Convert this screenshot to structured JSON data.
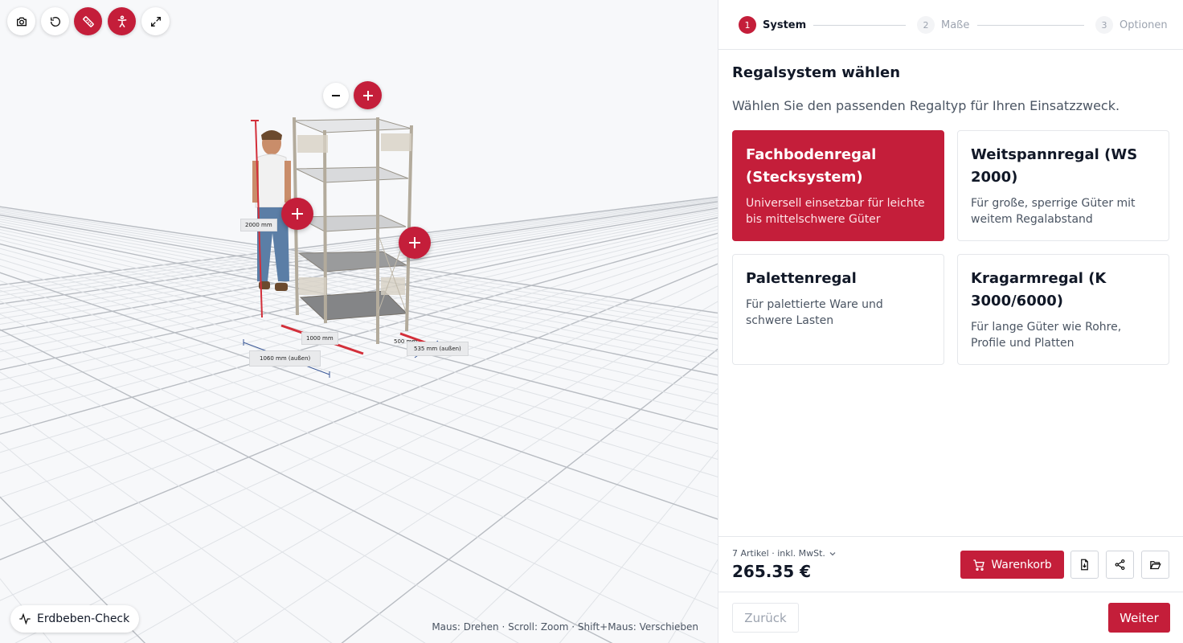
{
  "toolbar": {
    "buttons": [
      {
        "icon": "camera-icon"
      },
      {
        "icon": "reset-view-icon"
      },
      {
        "icon": "ruler-icon"
      },
      {
        "icon": "person-icon"
      },
      {
        "icon": "fullscreen-icon"
      }
    ]
  },
  "viewport": {
    "dimensions": {
      "height": "2000 mm",
      "width": "1000 mm",
      "width_outer": "1060 mm (außen)",
      "depth": "500 mm",
      "depth_outer": "535 mm (außen)"
    },
    "earthquake_check": "Erdbeben-Check",
    "hint": "Maus: Drehen · Scroll: Zoom · Shift+Maus: Verschieben"
  },
  "stepper": {
    "steps": [
      {
        "num": "1",
        "label": "System"
      },
      {
        "num": "2",
        "label": "Maße"
      },
      {
        "num": "3",
        "label": "Optionen"
      }
    ]
  },
  "main": {
    "title": "Regalsystem wählen",
    "subtitle": "Wählen Sie den passenden Regaltyp für Ihren Einsatzzweck.",
    "cards": [
      {
        "title": "Fachbodenregal (Stecksystem)",
        "desc": "Universell einsetzbar für leichte bis mittelschwere Güter",
        "selected": true
      },
      {
        "title": "Weitspannregal (WS 2000)",
        "desc": "Für große, sperrige Güter mit weitem Regalabstand",
        "selected": false
      },
      {
        "title": "Palettenregal",
        "desc": "Für palettierte Ware und schwere Lasten",
        "selected": false
      },
      {
        "title": "Kragarmregal (K 3000/6000)",
        "desc": "Für lange Güter wie Rohre, Profile und Platten",
        "selected": false
      }
    ]
  },
  "summary": {
    "items": "7 Artikel · inkl. MwSt.",
    "price": "265.35 €",
    "cart_label": "Warenkorb"
  },
  "nav": {
    "back": "Zurück",
    "next": "Weiter"
  },
  "colors": {
    "accent": "#c41e3a"
  }
}
